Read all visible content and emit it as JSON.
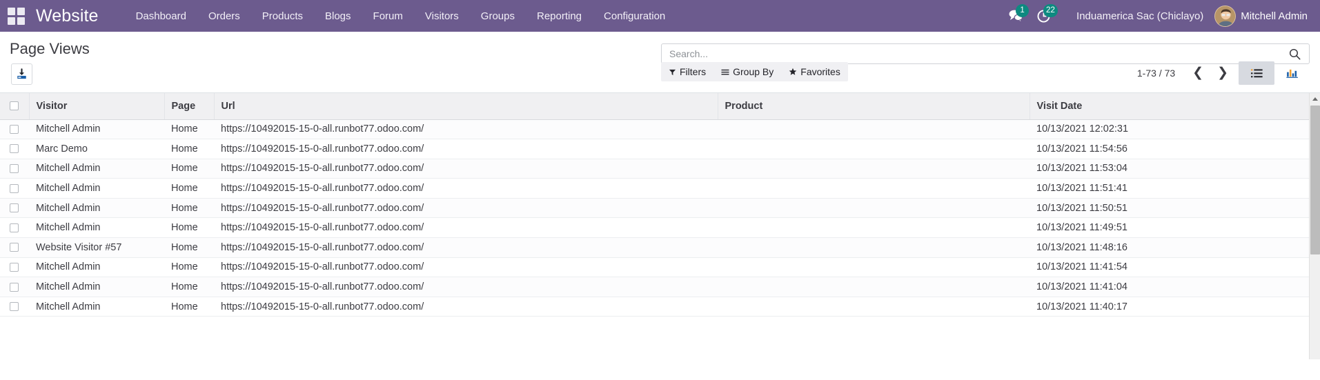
{
  "theme": {
    "navbar_bg": "#6c5b8e",
    "badge_bg": "#0d8a80",
    "text_dark": "#3c3c42",
    "header_bg": "#f0f0f2"
  },
  "navbar": {
    "apps_icon": "apps-grid-icon",
    "brand": "Website",
    "menu": [
      {
        "label": "Dashboard"
      },
      {
        "label": "Orders"
      },
      {
        "label": "Products"
      },
      {
        "label": "Blogs"
      },
      {
        "label": "Forum"
      },
      {
        "label": "Visitors"
      },
      {
        "label": "Groups"
      },
      {
        "label": "Reporting"
      },
      {
        "label": "Configuration"
      }
    ],
    "messages_icon": "comments-icon",
    "messages_count": "1",
    "activities_icon": "clock-icon",
    "activities_count": "22",
    "company": "Induamerica Sac (Chiclayo)",
    "user_name": "Mitchell Admin",
    "avatar_icon": "user-avatar"
  },
  "control_panel": {
    "title": "Page Views",
    "export_icon": "download-icon",
    "search": {
      "placeholder": "Search...",
      "value": "",
      "icon": "search-icon"
    },
    "filters": [
      {
        "label": "Filters",
        "icon": "funnel-icon"
      },
      {
        "label": "Group By",
        "icon": "list-lines-icon"
      },
      {
        "label": "Favorites",
        "icon": "star-icon"
      }
    ],
    "pager": {
      "count": "1-73 / 73",
      "prev_icon": "chevron-left-icon",
      "next_icon": "chevron-right-icon"
    },
    "views": [
      {
        "name": "list",
        "icon": "list-view-icon",
        "active": true
      },
      {
        "name": "graph",
        "icon": "bar-chart-icon",
        "active": false
      }
    ]
  },
  "table": {
    "columns": [
      "Visitor",
      "Page",
      "Url",
      "Product",
      "Visit Date"
    ],
    "rows": [
      {
        "visitor": "Mitchell Admin",
        "page": "Home",
        "url": "https://10492015-15-0-all.runbot77.odoo.com/",
        "product": "",
        "date": "10/13/2021 12:02:31"
      },
      {
        "visitor": "Marc Demo",
        "page": "Home",
        "url": "https://10492015-15-0-all.runbot77.odoo.com/",
        "product": "",
        "date": "10/13/2021 11:54:56"
      },
      {
        "visitor": "Mitchell Admin",
        "page": "Home",
        "url": "https://10492015-15-0-all.runbot77.odoo.com/",
        "product": "",
        "date": "10/13/2021 11:53:04"
      },
      {
        "visitor": "Mitchell Admin",
        "page": "Home",
        "url": "https://10492015-15-0-all.runbot77.odoo.com/",
        "product": "",
        "date": "10/13/2021 11:51:41"
      },
      {
        "visitor": "Mitchell Admin",
        "page": "Home",
        "url": "https://10492015-15-0-all.runbot77.odoo.com/",
        "product": "",
        "date": "10/13/2021 11:50:51"
      },
      {
        "visitor": "Mitchell Admin",
        "page": "Home",
        "url": "https://10492015-15-0-all.runbot77.odoo.com/",
        "product": "",
        "date": "10/13/2021 11:49:51"
      },
      {
        "visitor": "Website Visitor #57",
        "page": "Home",
        "url": "https://10492015-15-0-all.runbot77.odoo.com/",
        "product": "",
        "date": "10/13/2021 11:48:16"
      },
      {
        "visitor": "Mitchell Admin",
        "page": "Home",
        "url": "https://10492015-15-0-all.runbot77.odoo.com/",
        "product": "",
        "date": "10/13/2021 11:41:54"
      },
      {
        "visitor": "Mitchell Admin",
        "page": "Home",
        "url": "https://10492015-15-0-all.runbot77.odoo.com/",
        "product": "",
        "date": "10/13/2021 11:41:04"
      },
      {
        "visitor": "Mitchell Admin",
        "page": "Home",
        "url": "https://10492015-15-0-all.runbot77.odoo.com/",
        "product": "",
        "date": "10/13/2021 11:40:17"
      }
    ]
  }
}
